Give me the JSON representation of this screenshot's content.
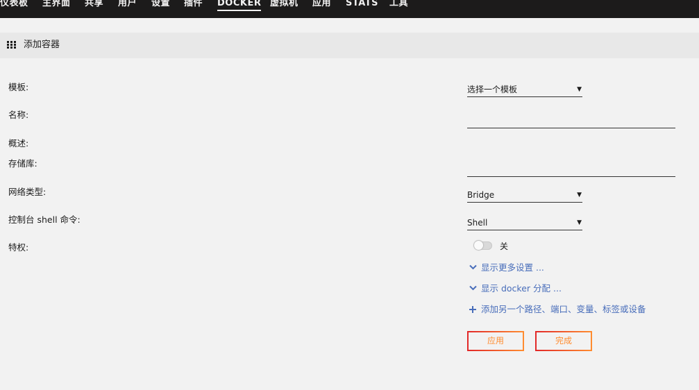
{
  "nav": {
    "items": [
      {
        "label": "仪表板"
      },
      {
        "label": "主界面"
      },
      {
        "label": "共享"
      },
      {
        "label": "用户"
      },
      {
        "label": "设置"
      },
      {
        "label": "插件"
      },
      {
        "label": "DOCKER",
        "active": true
      },
      {
        "label": "虚拟机"
      },
      {
        "label": "应用"
      },
      {
        "label": "STATS"
      },
      {
        "label": "工具"
      }
    ]
  },
  "section": {
    "icon": "grid-icon",
    "title": "添加容器"
  },
  "form": {
    "template_label": "模板:",
    "template_value": "选择一个模板",
    "name_label": "名称:",
    "name_value": "",
    "overview_label": "概述:",
    "repository_label": "存储库:",
    "repository_value": "",
    "network_label": "网络类型:",
    "network_value": "Bridge",
    "console_label": "控制台 shell 命令:",
    "console_value": "Shell",
    "privileged_label": "特权:",
    "privileged_state": "关"
  },
  "links": {
    "more_settings": "显示更多设置 ...",
    "docker_alloc": "显示 docker 分配 ...",
    "add_another": "添加另一个路径、端口、变量、标签或设备"
  },
  "buttons": {
    "apply": "应用",
    "done": "完成"
  },
  "colors": {
    "nav_bg": "#1c1b1b",
    "link": "#486dba",
    "button_text": "#ff8c2f",
    "button_border_start": "#e22828",
    "button_border_end": "#ff8c2f"
  }
}
